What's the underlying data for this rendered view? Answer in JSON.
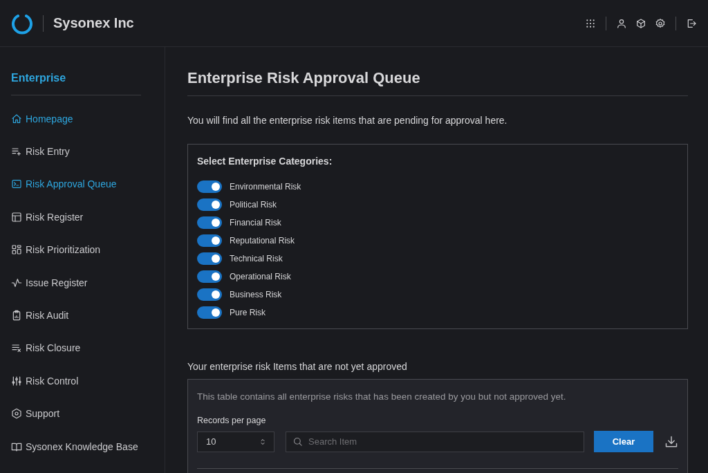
{
  "header": {
    "brand": "Sysonex Inc"
  },
  "sidebar": {
    "title": "Enterprise",
    "items": [
      {
        "label": "Homepage",
        "selected": true
      },
      {
        "label": "Risk Entry",
        "selected": false
      },
      {
        "label": "Risk Approval Queue",
        "selected": true
      },
      {
        "label": "Risk Register",
        "selected": false
      },
      {
        "label": "Risk Prioritization",
        "selected": false
      },
      {
        "label": "Issue Register",
        "selected": false
      },
      {
        "label": "Risk Audit",
        "selected": false
      },
      {
        "label": "Risk Closure",
        "selected": false
      },
      {
        "label": "Risk Control",
        "selected": false
      },
      {
        "label": "Support",
        "selected": false
      },
      {
        "label": "Sysonex Knowledge Base",
        "selected": false
      }
    ]
  },
  "page": {
    "title": "Enterprise Risk Approval Queue",
    "intro": "You will find all the enterprise risk items that are pending for approval here."
  },
  "categories": {
    "heading": "Select Enterprise Categories:",
    "items": [
      {
        "label": "Environmental Risk",
        "on": true
      },
      {
        "label": "Political Risk",
        "on": true
      },
      {
        "label": "Financial Risk",
        "on": true
      },
      {
        "label": "Reputational Risk",
        "on": true
      },
      {
        "label": "Technical Risk",
        "on": true
      },
      {
        "label": "Operational Risk",
        "on": true
      },
      {
        "label": "Business Risk",
        "on": true
      },
      {
        "label": "Pure Risk",
        "on": true
      }
    ]
  },
  "table_section": {
    "heading": "Your enterprise risk Items that are not yet approved",
    "description": "This table contains all enterprise risks that has been created by you but not approved yet.",
    "records_label": "Records per page",
    "records_value": "10",
    "search": {
      "placeholder": "Search Item"
    },
    "clear_button": "Clear"
  }
}
